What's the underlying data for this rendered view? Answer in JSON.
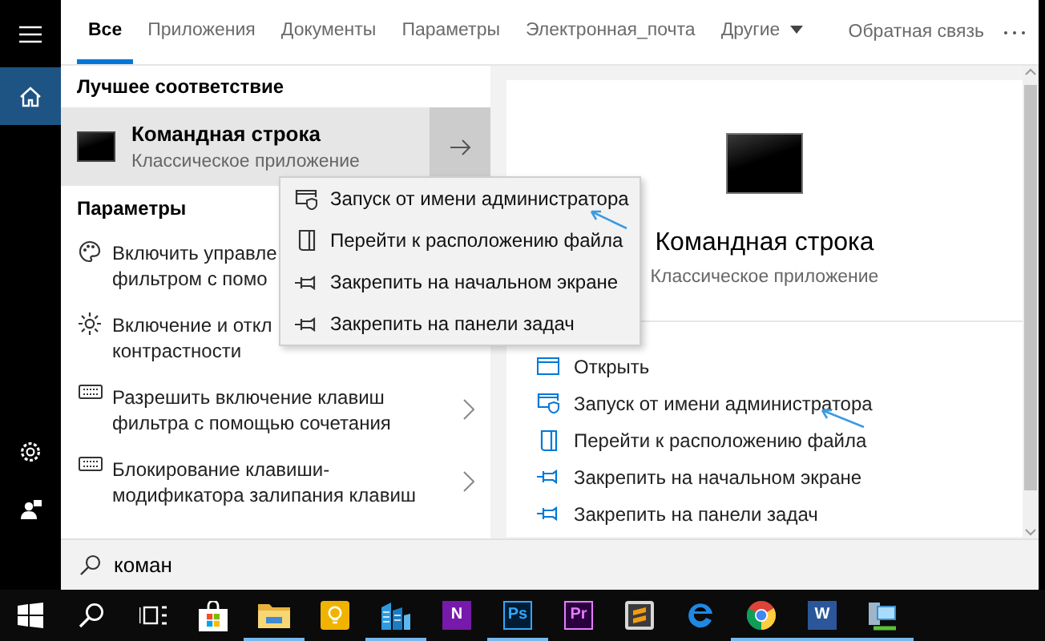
{
  "sidebar": {
    "items": [
      {
        "kind": "menu",
        "selected": false
      },
      {
        "kind": "home",
        "selected": true
      },
      {
        "kind": "settings",
        "selected": false
      },
      {
        "kind": "user",
        "selected": false
      }
    ]
  },
  "tabs": [
    {
      "label": "Все",
      "selected": true
    },
    {
      "label": "Приложения",
      "selected": false
    },
    {
      "label": "Документы",
      "selected": false
    },
    {
      "label": "Параметры",
      "selected": false
    },
    {
      "label": "Электронная_почта",
      "selected": false
    },
    {
      "label": "Другие",
      "selected": false,
      "dropdown": true
    }
  ],
  "feedback": "Обратная связь",
  "best_match": {
    "heading": "Лучшее соответствие",
    "title": "Командная строка",
    "subtitle": "Классическое приложение"
  },
  "settings_section": {
    "heading": "Параметры",
    "items": [
      {
        "kind": "palette",
        "text": "Включить управле\nфильтром с помо",
        "chevron": false
      },
      {
        "kind": "sun",
        "text": "Включение и откл\nконтрастности",
        "chevron": false
      },
      {
        "kind": "keyboard",
        "text": "Разрешить включение клавиш\nфильтра с помощью сочетания",
        "chevron": true
      },
      {
        "kind": "keyboard",
        "text": "Блокирование клавиши-\nмодификатора залипания клавиш",
        "chevron": true
      }
    ]
  },
  "context_menu": {
    "items": [
      {
        "kind": "admin",
        "label": "Запуск от имени администратора"
      },
      {
        "kind": "folder",
        "label": "Перейти к расположению файла"
      },
      {
        "kind": "pin",
        "label": "Закрепить на начальном экране"
      },
      {
        "kind": "pin",
        "label": "Закрепить на панели задач"
      }
    ]
  },
  "preview": {
    "title": "Командная строка",
    "subtitle": "Классическое приложение",
    "actions": [
      {
        "kind": "open",
        "label": "Открыть"
      },
      {
        "kind": "admin",
        "label": "Запуск от имени администратора"
      },
      {
        "kind": "folder",
        "label": "Перейти к расположению файла"
      },
      {
        "kind": "pin",
        "label": "Закрепить на начальном экране"
      },
      {
        "kind": "pin",
        "label": "Закрепить на панели задач"
      }
    ]
  },
  "search": {
    "value": "коман"
  },
  "taskbar": {
    "apps": [
      {
        "kind": "start",
        "running": false
      },
      {
        "kind": "search",
        "running": false
      },
      {
        "kind": "taskview",
        "running": false
      },
      {
        "kind": "store",
        "running": false
      },
      {
        "kind": "explorer",
        "running": true
      },
      {
        "kind": "tips",
        "running": false
      },
      {
        "kind": "building",
        "running": true
      },
      {
        "kind": "onenote",
        "label": "N",
        "running": false
      },
      {
        "kind": "photoshop",
        "label": "Ps",
        "running": true
      },
      {
        "kind": "premiere",
        "label": "Pr",
        "running": false
      },
      {
        "kind": "sublime",
        "running": false
      },
      {
        "kind": "edge",
        "running": false
      },
      {
        "kind": "chrome",
        "running": true
      },
      {
        "kind": "word",
        "label": "W",
        "running": true
      },
      {
        "kind": "network",
        "running": true
      }
    ]
  }
}
